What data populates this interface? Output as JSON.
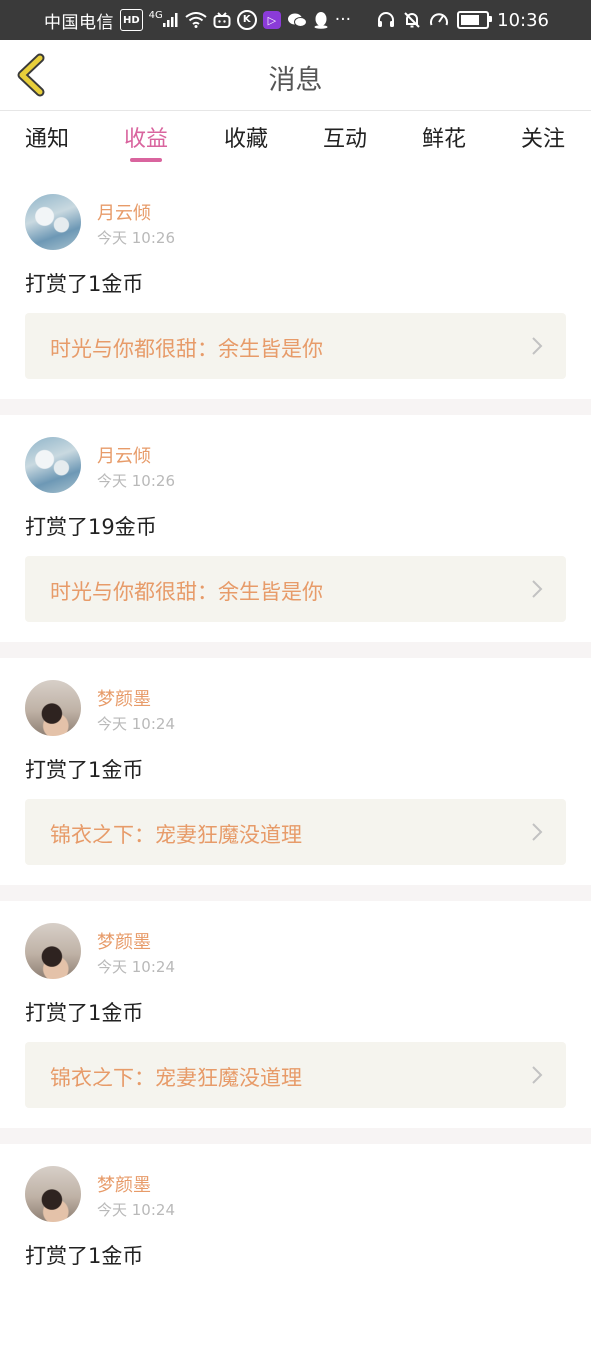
{
  "status_bar": {
    "carrier": "中国电信",
    "hd": "HD",
    "network": "4G",
    "k_badge": "K",
    "ellipsis": "···",
    "time": "10:36",
    "battery_level": 0.9
  },
  "header": {
    "title": "消息",
    "back_icon": "chevron-left-icon",
    "back_color": "#e8cf3a"
  },
  "tabs": [
    {
      "label": "通知",
      "active": false
    },
    {
      "label": "收益",
      "active": true
    },
    {
      "label": "收藏",
      "active": false
    },
    {
      "label": "互动",
      "active": false
    },
    {
      "label": "鲜花",
      "active": false
    },
    {
      "label": "关注",
      "active": false
    }
  ],
  "colors": {
    "accent": "#d9649e",
    "username": "#e79b69",
    "book_link_bg": "#f5f4ee"
  },
  "messages": [
    {
      "username": "月云倾",
      "time": "今天 10:26",
      "action": "打赏了1金币",
      "book": "时光与你都很甜：余生皆是你",
      "avatar": "clouds"
    },
    {
      "username": "月云倾",
      "time": "今天 10:26",
      "action": "打赏了19金币",
      "book": "时光与你都很甜：余生皆是你",
      "avatar": "clouds"
    },
    {
      "username": "梦颜墨",
      "time": "今天 10:24",
      "action": "打赏了1金币",
      "book": "锦衣之下：宠妻狂魔没道理",
      "avatar": "person"
    },
    {
      "username": "梦颜墨",
      "time": "今天 10:24",
      "action": "打赏了1金币",
      "book": "锦衣之下：宠妻狂魔没道理",
      "avatar": "person"
    },
    {
      "username": "梦颜墨",
      "time": "今天 10:24",
      "action": "打赏了1金币",
      "book": "",
      "avatar": "person"
    }
  ]
}
